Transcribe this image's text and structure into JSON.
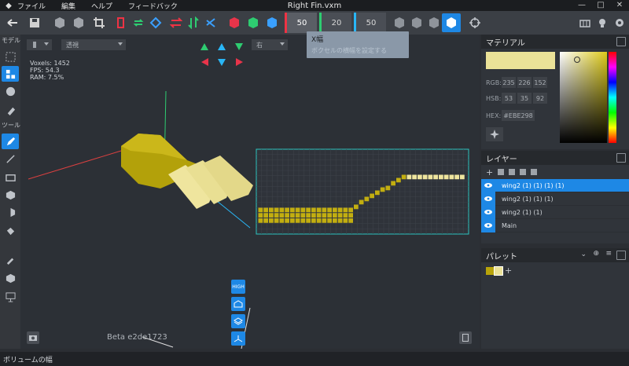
{
  "app": {
    "title": "Right Fin.vxm"
  },
  "menu": [
    "ファイル",
    "編集",
    "ヘルプ",
    "フィードバック"
  ],
  "toolbar": {
    "field_x": "50",
    "field_y": "20",
    "field_z": "50",
    "accent": "#1e88e5"
  },
  "tooltip": {
    "title": "X幅",
    "desc": "ボクセルの横幅を設定する"
  },
  "left_tools": {
    "model_label": "モデル",
    "tools_label": "ツール"
  },
  "viewport": {
    "projection": "",
    "view": "透視",
    "direction": "右",
    "stats": {
      "voxels": "Voxels: 1452",
      "fps": "FPS: 54.3",
      "ram": "RAM: 7.5%"
    },
    "beta": "Beta e2de1723",
    "quality_label": "HIGH"
  },
  "material": {
    "title": "マテリアル",
    "rgb_label": "RGB:",
    "rgb": [
      "235",
      "226",
      "152"
    ],
    "hsb_label": "HSB:",
    "hsb": [
      "53",
      "35",
      "92"
    ],
    "hex_label": "HEX:",
    "hex": "#EBE298",
    "color": "#ebe298"
  },
  "layers": {
    "title": "レイヤー",
    "items": [
      {
        "name": "wing2 (1) (1) (1) (1)",
        "selected": true
      },
      {
        "name": "wing2 (1) (1) (1)",
        "selected": false
      },
      {
        "name": "wing2 (1) (1)",
        "selected": false
      },
      {
        "name": "Main",
        "selected": false
      }
    ]
  },
  "palette": {
    "title": "パレット",
    "colors": [
      "#b8a40a",
      "#ebe298"
    ]
  },
  "status": {
    "text": "ボリュームの幅"
  }
}
